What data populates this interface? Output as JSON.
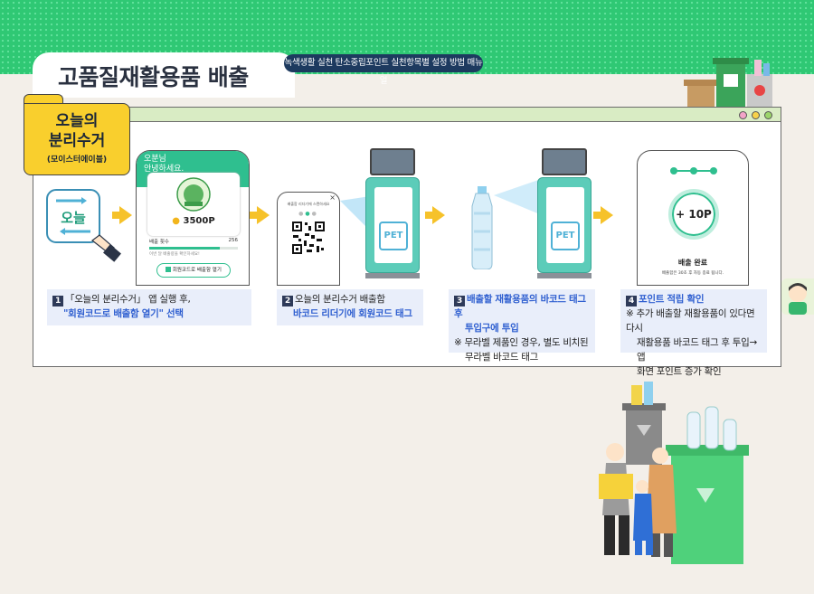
{
  "header": {
    "title": "고품질재활용품 배출",
    "subtitle": "녹색생활 실천 탄소중립포인트 실천항목별 설정 방법 매뉴얼"
  },
  "badge": {
    "line1": "오늘의",
    "line2": "분리수거",
    "line3": "(모이스터에이블)"
  },
  "window_dots": [
    "#f3a4c8",
    "#f7d24a",
    "#9cd56b"
  ],
  "phone1": {
    "greeting1": "오분님",
    "greeting2": "안녕하세요.",
    "points": "3500P",
    "count_label": "배출 횟수",
    "count_value": "256",
    "note": "이번 달 배출량을 확인하세요!",
    "open_button": "회원코드로 배출함 열기"
  },
  "phone2": {
    "hint": "배출함 리더기에 스캔하세요"
  },
  "kiosk": {
    "pet_label": "PET"
  },
  "phone4": {
    "points": "+ 10P",
    "done_title": "배출 완료",
    "done_sub": "배출함은 30초 후 자동 종료 됩니다."
  },
  "steps": [
    {
      "num": "1",
      "line1": "「오늘의 분리수거」 앱 실행 후,",
      "line2": "\"회원코드로 배출함 열기\" 선택"
    },
    {
      "num": "2",
      "line1": "오늘의 분리수거 배출함",
      "line2": "바코드 리더기에 회원코드 태그"
    },
    {
      "num": "3",
      "line1": "배출할 재활용품의 바코드 태그 후",
      "line2": "투입구에 투입",
      "note1": "※ 무라벨 제품인 경우, 별도 비치된",
      "note2": "무라벨 바코드 태그"
    },
    {
      "num": "4",
      "line1": "포인트 적립 확인",
      "note1": "※ 추가 배출할 재활용품이 있다면 다시",
      "note2": "재활용품 바코드 태그 후 투입→앱",
      "note3": "화면 포인트 증가 확인"
    }
  ]
}
